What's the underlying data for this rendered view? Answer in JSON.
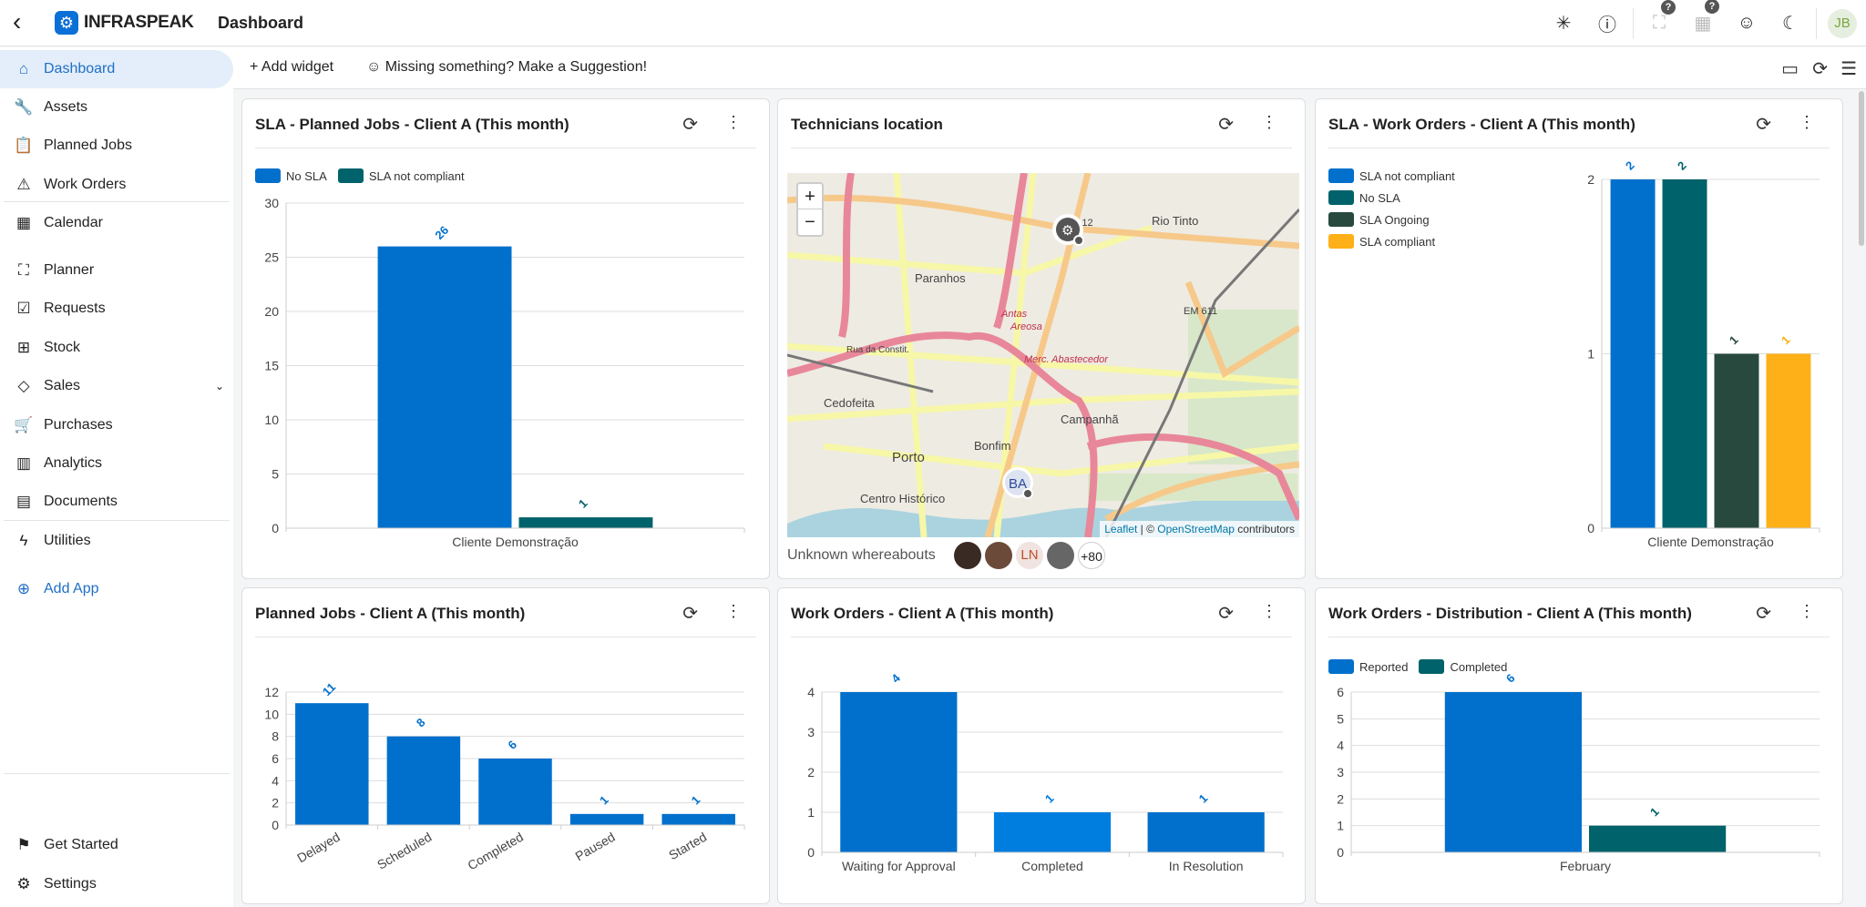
{
  "header": {
    "back": "‹",
    "logo": "INFRASPEAK",
    "title": "Dashboard",
    "avatar": "JB",
    "help_badge": "?"
  },
  "sidebar": {
    "items": [
      {
        "label": "Dashboard",
        "icon": "home-icon",
        "glyph": "⌂"
      },
      {
        "label": "Assets",
        "icon": "wrench-icon",
        "glyph": "🔧"
      },
      {
        "label": "Planned Jobs",
        "icon": "clipboard-icon",
        "glyph": "📋"
      },
      {
        "label": "Work Orders",
        "icon": "warning-icon",
        "glyph": "⚠"
      },
      {
        "label": "Calendar",
        "icon": "calendar-icon",
        "glyph": "▦"
      },
      {
        "label": "Planner",
        "icon": "planner-icon",
        "glyph": "⛶"
      },
      {
        "label": "Requests",
        "icon": "chat-check-icon",
        "glyph": "☑"
      },
      {
        "label": "Stock",
        "icon": "gift-box-icon",
        "glyph": "⊞"
      },
      {
        "label": "Sales",
        "icon": "tag-icon",
        "glyph": "◇"
      },
      {
        "label": "Purchases",
        "icon": "cart-icon",
        "glyph": "🛒"
      },
      {
        "label": "Analytics",
        "icon": "bar-chart-icon",
        "glyph": "▥"
      },
      {
        "label": "Documents",
        "icon": "document-icon",
        "glyph": "▤"
      },
      {
        "label": "Utilities",
        "icon": "bolt-icon",
        "glyph": "ϟ"
      },
      {
        "label": "Add App",
        "icon": "plus-circle-icon",
        "glyph": "⊕"
      },
      {
        "label": "Get Started",
        "icon": "flag-icon",
        "glyph": "⚑"
      },
      {
        "label": "Settings",
        "icon": "gear-icon",
        "glyph": "⚙"
      }
    ]
  },
  "toolbar": {
    "add_widget": "+ Add widget",
    "suggestion": "☺ Missing something? Make a Suggestion!"
  },
  "colors": {
    "blue": "#0070cc",
    "light_blue": "#007ee0",
    "teal": "#00626a",
    "dark_green": "#284a3e",
    "orange": "#fdb017"
  },
  "widgets": {
    "map": {
      "title": "Technicians location",
      "zoom_in": "+",
      "zoom_out": "−",
      "attribution_leaflet": "Leaflet",
      "attribution_sep": " | © ",
      "attribution_osm": "OpenStreetMap",
      "attribution_tail": " contributors",
      "unknown": "Unknown whereabouts",
      "avatars": [
        "",
        "",
        "LN",
        ""
      ],
      "more": "+80",
      "marker_ba": "BA",
      "places": [
        "Paranhos",
        "Rio Tinto",
        "Cedofeita",
        "Porto",
        "Bonfim",
        "Campanhã",
        "Centro Histórico",
        "EN 12",
        "EM 611",
        "Rua da Constit.",
        "Merc. Abastecedor",
        "Antas",
        "Areosa"
      ]
    }
  },
  "chart_data": [
    {
      "title": "SLA - Planned Jobs - Client A (This month)",
      "type": "bar",
      "categories": [
        "Cliente Demonstração"
      ],
      "series": [
        {
          "name": "No SLA",
          "color": "#0070cc",
          "values": [
            26
          ]
        },
        {
          "name": "SLA not compliant",
          "color": "#00626a",
          "values": [
            1
          ]
        }
      ],
      "ylim": [
        0,
        30
      ],
      "yticks": [
        0,
        5,
        10,
        15,
        20,
        25,
        30
      ],
      "legend": "top-left",
      "grid": true
    },
    {
      "title": "SLA - Work Orders - Client A (This month)",
      "type": "bar",
      "categories": [
        "Cliente Demonstração"
      ],
      "series": [
        {
          "name": "SLA not compliant",
          "color": "#0070cc",
          "values": [
            2
          ]
        },
        {
          "name": "No SLA",
          "color": "#00626a",
          "values": [
            2
          ]
        },
        {
          "name": "SLA Ongoing",
          "color": "#284a3e",
          "values": [
            1
          ]
        },
        {
          "name": "SLA compliant",
          "color": "#fdb017",
          "values": [
            1
          ]
        }
      ],
      "ylim": [
        0,
        2
      ],
      "yticks": [
        0,
        1,
        2
      ],
      "legend": "left",
      "grid": true
    },
    {
      "title": "Planned Jobs - Client A (This month)",
      "type": "bar",
      "categories": [
        "Delayed",
        "Scheduled",
        "Completed",
        "Paused",
        "Started"
      ],
      "series": [
        {
          "color": "#0070cc",
          "values": [
            11,
            8,
            6,
            1,
            1
          ]
        }
      ],
      "ylim": [
        0,
        12
      ],
      "yticks": [
        0,
        2,
        4,
        6,
        8,
        10,
        12
      ],
      "grid": true
    },
    {
      "title": "Work Orders - Client A (This month)",
      "type": "bar",
      "categories": [
        "Waiting for Approval",
        "Completed",
        "In Resolution"
      ],
      "series": [
        {
          "color": "#0070cc",
          "colors": [
            "#0070cc",
            "#007ee0",
            "#0070cc"
          ],
          "values": [
            4,
            1,
            1
          ]
        }
      ],
      "ylim": [
        0,
        4
      ],
      "yticks": [
        0,
        1,
        2,
        3,
        4
      ],
      "grid": true
    },
    {
      "title": "Work Orders - Distribution - Client A (This month)",
      "type": "bar",
      "categories": [
        "February"
      ],
      "series": [
        {
          "name": "Reported",
          "color": "#0070cc",
          "values": [
            6
          ]
        },
        {
          "name": "Completed",
          "color": "#00626a",
          "values": [
            1
          ]
        }
      ],
      "ylim": [
        0,
        6
      ],
      "yticks": [
        0,
        1,
        2,
        3,
        4,
        5,
        6
      ],
      "legend": "top-left",
      "grid": true
    }
  ]
}
